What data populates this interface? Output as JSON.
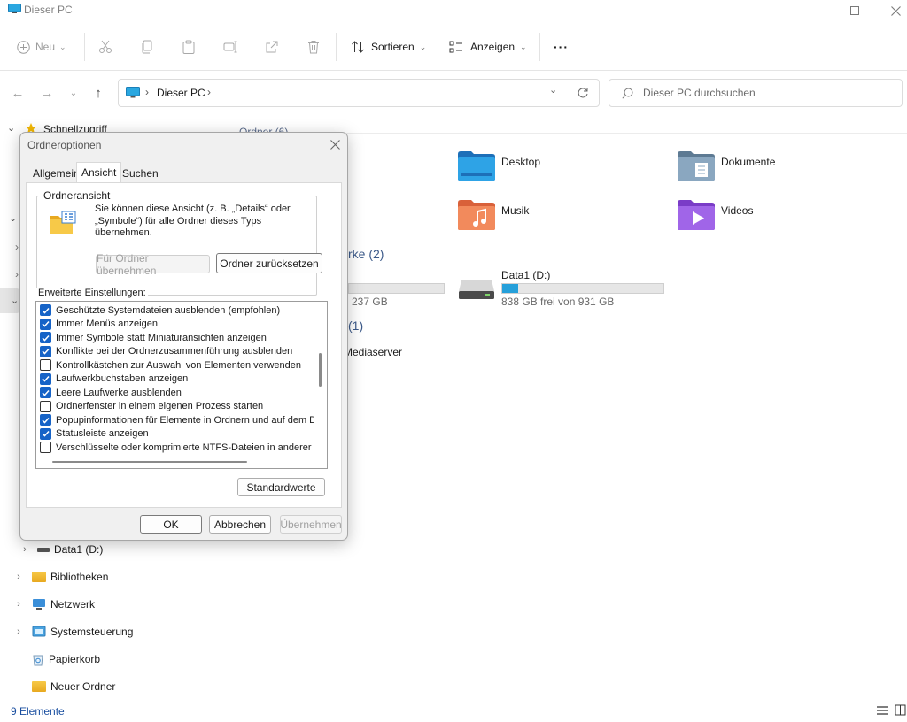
{
  "window": {
    "title": "Dieser PC"
  },
  "toolbar": {
    "new_label": "Neu",
    "sort_label": "Sortieren",
    "view_label": "Anzeigen",
    "more_label": "···"
  },
  "address": {
    "path": "Dieser PC",
    "search_placeholder": "Dieser PC durchsuchen"
  },
  "sidebar": {
    "quick_access": "Schnellzugriff",
    "items": [
      {
        "label": "Data1 (D:)"
      },
      {
        "label": "Bibliotheken"
      },
      {
        "label": "Netzwerk"
      },
      {
        "label": "Systemsteuerung"
      },
      {
        "label": "Papierkorb"
      },
      {
        "label": "Neuer Ordner"
      }
    ]
  },
  "content": {
    "group_folders_partial": "Ordner (6)",
    "folders": [
      {
        "label": "Desktop",
        "icon": "desktop-folder-icon"
      },
      {
        "label": "Dokumente",
        "icon": "documents-folder-icon"
      },
      {
        "label": "Musik",
        "icon": "music-folder-icon"
      },
      {
        "label": "Videos",
        "icon": "videos-folder-icon"
      }
    ],
    "group_drives_partial": "rke (2)",
    "drive_c_free_partial": "237 GB",
    "drive_c_usage": 0.95,
    "drive_d": {
      "label": "Data1 (D:)",
      "free": "838 GB frei von 931 GB",
      "usage": 0.1
    },
    "group_net_partial": "(1)",
    "net_item_partial": "Mediaserver"
  },
  "status": {
    "count": "9 Elemente"
  },
  "dialog": {
    "title": "Ordneroptionen",
    "tabs": [
      "Allgemein",
      "Ansicht",
      "Suchen"
    ],
    "active_tab": 1,
    "group_title": "Ordneransicht",
    "group_text": "Sie können diese Ansicht (z. B. „Details“ oder „Symbole“) für alle Ordner dieses Typs übernehmen.",
    "apply_folders_button": "Für Ordner übernehmen",
    "reset_folders_button": "Ordner zurücksetzen",
    "advanced_label": "Erweiterte Einstellungen:",
    "options": [
      {
        "label": "Geschützte Systemdateien ausblenden (empfohlen)",
        "checked": true
      },
      {
        "label": "Immer Menüs anzeigen",
        "checked": true
      },
      {
        "label": "Immer Symbole statt Miniaturansichten anzeigen",
        "checked": true
      },
      {
        "label": "Konflikte bei der Ordnerzusammenführung ausblenden",
        "checked": true
      },
      {
        "label": "Kontrollkästchen zur Auswahl von Elementen verwenden",
        "checked": false
      },
      {
        "label": "Laufwerkbuchstaben anzeigen",
        "checked": true
      },
      {
        "label": "Leere Laufwerke ausblenden",
        "checked": true
      },
      {
        "label": "Ordnerfenster in einem eigenen Prozess starten",
        "checked": false
      },
      {
        "label": "Popupinformationen für Elemente in Ordnern und auf dem D",
        "checked": true
      },
      {
        "label": "Statusleiste anzeigen",
        "checked": true
      },
      {
        "label": "Verschlüsselte oder komprimierte NTFS-Dateien in anderer",
        "checked": false
      }
    ],
    "defaults_button": "Standardwerte",
    "ok_button": "OK",
    "cancel_button": "Abbrechen",
    "apply_button": "Übernehmen"
  }
}
